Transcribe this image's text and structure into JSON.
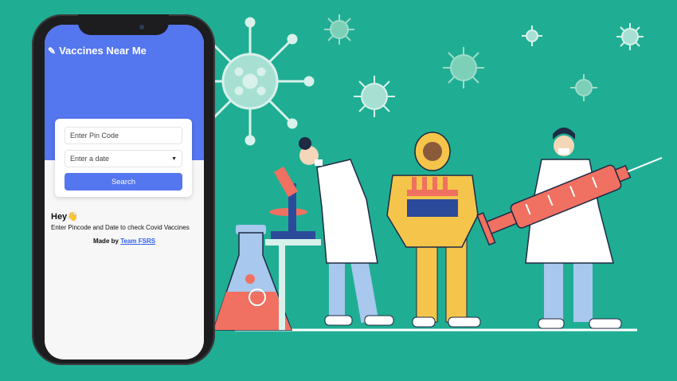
{
  "app": {
    "title": "Vaccines Near Me",
    "icon": "pencil-icon"
  },
  "form": {
    "pin_placeholder": "Enter Pin Code",
    "date_placeholder": "Enter a date",
    "search_label": "Search"
  },
  "content": {
    "greeting": "Hey👋",
    "instruction": "Enter Pincode and Date to check Covid Vaccines",
    "made_by_prefix": "Made by",
    "team_name": "Team FSRS"
  },
  "colors": {
    "background": "#1fae94",
    "accent": "#5476ef",
    "coral": "#f07061",
    "yellow": "#f4c54a",
    "light_blue": "#a8c8ee"
  }
}
